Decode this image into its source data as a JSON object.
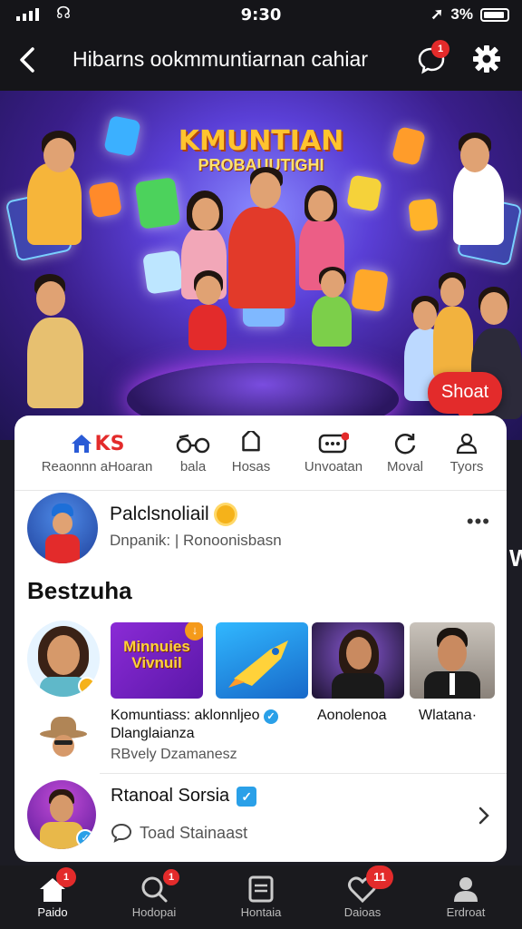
{
  "status_bar": {
    "time": "9:30",
    "battery": "3%"
  },
  "header": {
    "title": "Hibarns ookmmuntiarnan cahiar",
    "chat_badge": "1"
  },
  "hero": {
    "headline": "KMUNTIAN",
    "subline": "PROBAUUTIGHI"
  },
  "shout_button": {
    "label": "Shoat"
  },
  "tabs": [
    {
      "label": "Reaonnn aHoaran",
      "icon": "home-icon",
      "brand": "KS"
    },
    {
      "label": "bala",
      "icon": "glasses-icon"
    },
    {
      "label": "Hosas",
      "icon": "tag-icon"
    },
    {
      "label": "Unvoatan",
      "icon": "message-icon"
    },
    {
      "label": "Moval",
      "icon": "refresh-icon"
    },
    {
      "label": "Tyors",
      "icon": "people-icon"
    }
  ],
  "post": {
    "name": "Palclsnoliail",
    "subtitle": "Dnpanik: | Ronoonisbasn",
    "more": "•••"
  },
  "section": {
    "title": "Bestzuha",
    "peek": "W"
  },
  "stories": {
    "thumb1_text": "Minnuies Vivnuil",
    "thumb1_badge": "↓",
    "captions": [
      "Komuntiass: aklonnljeo",
      "Aonolenoa",
      "Wlatana·"
    ],
    "caption1_sub": "Dlanglaianza",
    "caption1_meta": "RBvely Dzamanesz"
  },
  "suggested": {
    "name": "Rtanoal Sorsia",
    "action": "Toad Stainaast"
  },
  "bottom_nav": [
    {
      "label": "Paido",
      "icon": "home-icon",
      "badge": "1"
    },
    {
      "label": "Hodopai",
      "icon": "search-icon",
      "badge": "1"
    },
    {
      "label": "Hontaia",
      "icon": "news-icon"
    },
    {
      "label": "Daioas",
      "icon": "heart-icon",
      "badge": "11"
    },
    {
      "label": "Erdroat",
      "icon": "profile-icon"
    }
  ],
  "colors": {
    "accent": "#e32b2b",
    "verified": "#2aa0e8",
    "header_bg": "#151519"
  }
}
